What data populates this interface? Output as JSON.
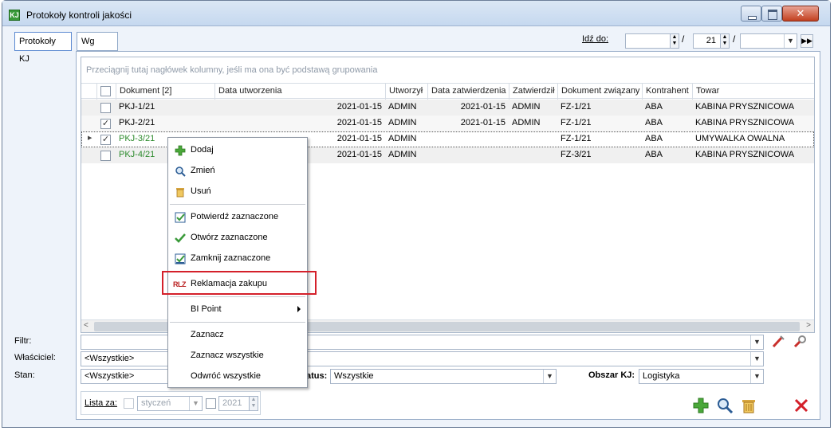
{
  "window": {
    "title": "Protokoły kontroli jakości",
    "app_icon": "KJ"
  },
  "tabs": [
    {
      "label": "Protokoły KJ"
    },
    {
      "label": "Wg daty"
    }
  ],
  "goto": {
    "label": "Idź do:",
    "date_value": "",
    "day_value": "21",
    "month_value": ""
  },
  "grid": {
    "group_hint": "Przeciągnij tutaj nagłówek kolumny, jeśli ma ona być podstawą grupowania",
    "columns": [
      "Dokument [2]",
      "Data utworzenia",
      "Utworzył",
      "Data zatwierdzenia",
      "Zatwierdził",
      "Dokument związany",
      "Kontrahent",
      "Towar"
    ],
    "rows": [
      {
        "checked": false,
        "doc": "PKJ-1/21",
        "created": "2021-01-15",
        "author": "ADMIN",
        "approved": "2021-01-15",
        "approver": "ADMIN",
        "related": "FZ-1/21",
        "contractor": "ABA",
        "item": "KABINA PRYSZNICOWA"
      },
      {
        "checked": true,
        "doc": "PKJ-2/21",
        "created": "2021-01-15",
        "author": "ADMIN",
        "approved": "2021-01-15",
        "approver": "ADMIN",
        "related": "FZ-1/21",
        "contractor": "ABA",
        "item": "KABINA PRYSZNICOWA"
      },
      {
        "checked": true,
        "doc": "PKJ-3/21",
        "created": "2021-01-15",
        "author": "ADMIN",
        "approved": "",
        "approver": "",
        "related": "FZ-1/21",
        "contractor": "ABA",
        "item": "UMYWALKA OWALNA"
      },
      {
        "checked": false,
        "doc": "PKJ-4/21",
        "created": "2021-01-15",
        "author": "ADMIN",
        "approved": "",
        "approver": "",
        "related": "FZ-3/21",
        "contractor": "ABA",
        "item": "KABINA PRYSZNICOWA"
      }
    ]
  },
  "context_menu": {
    "items": [
      {
        "label": "Dodaj",
        "icon": "plus-icon"
      },
      {
        "label": "Zmień",
        "icon": "magnifier-icon"
      },
      {
        "label": "Usuń",
        "icon": "trash-icon"
      },
      {
        "label": "Potwierdź zaznaczone",
        "icon": "checkbox-checked-icon"
      },
      {
        "label": "Otwórz zaznaczone",
        "icon": "checkmark-icon"
      },
      {
        "label": "Zamknij zaznaczone",
        "icon": "close-selected-icon"
      },
      {
        "label": "Reklamacja zakupu",
        "icon": "rlz-icon",
        "icon_text": "RLZ"
      },
      {
        "label": "BI Point",
        "icon": ""
      },
      {
        "label": "Zaznacz",
        "icon": ""
      },
      {
        "label": "Zaznacz wszystkie",
        "icon": ""
      },
      {
        "label": "Odwróć wszystkie",
        "icon": ""
      }
    ]
  },
  "filters": {
    "filter_label": "Filtr:",
    "owner_label": "Właściciel:",
    "owner_value": "<Wszystkie>",
    "state_label": "Stan:",
    "state_value": "<Wszystkie>",
    "status_label": "atus:",
    "status_value": "Wszystkie",
    "area_label": "Obszar KJ:",
    "area_value": "Logistyka"
  },
  "list_for": {
    "label": "Lista za:",
    "month_value": "styczeń",
    "year_value": "2021"
  },
  "colors": {
    "accent_green": "#2c8a2c",
    "highlight_red": "#d4202a"
  }
}
